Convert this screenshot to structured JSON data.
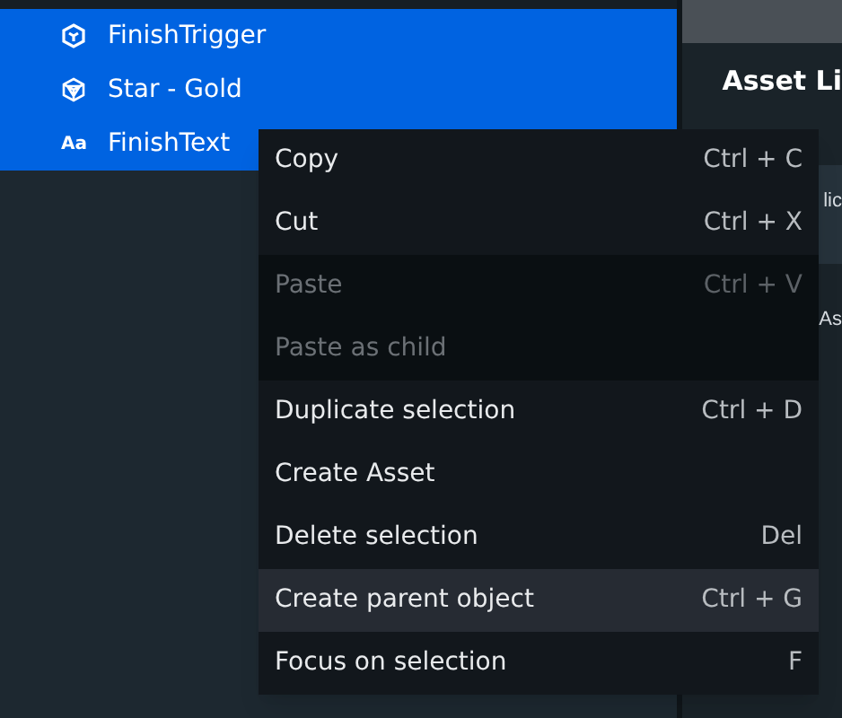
{
  "hierarchy": {
    "items": [
      {
        "label": "FinishTrigger",
        "kind": "cube",
        "selected": true
      },
      {
        "label": "Star - Gold",
        "kind": "mesh",
        "selected": true
      },
      {
        "label": "FinishText",
        "kind": "text",
        "icon_text": "Aa",
        "selected": true
      }
    ]
  },
  "right_panel": {
    "title": "Asset Li",
    "rows": [
      {
        "text": "lic",
        "selected": true
      },
      {
        "text": "As",
        "selected": false
      }
    ]
  },
  "context_menu": {
    "items": [
      {
        "label": "Copy",
        "shortcut": "Ctrl + C",
        "disabled": false,
        "hovered": false
      },
      {
        "label": "Cut",
        "shortcut": "Ctrl + X",
        "disabled": false,
        "hovered": false
      },
      {
        "label": "Paste",
        "shortcut": "Ctrl + V",
        "disabled": true,
        "hovered": false
      },
      {
        "label": "Paste as child",
        "disabled": true,
        "hovered": false
      },
      {
        "label": "Duplicate selection",
        "shortcut": "Ctrl + D",
        "disabled": false,
        "hovered": false
      },
      {
        "label": "Create Asset",
        "disabled": false,
        "hovered": false
      },
      {
        "label": "Delete selection",
        "shortcut": "Del",
        "disabled": false,
        "hovered": false
      },
      {
        "label": "Create parent object",
        "shortcut": "Ctrl + G",
        "disabled": false,
        "hovered": true
      },
      {
        "label": "Focus on selection",
        "shortcut": "F",
        "disabled": false,
        "hovered": false
      }
    ]
  }
}
